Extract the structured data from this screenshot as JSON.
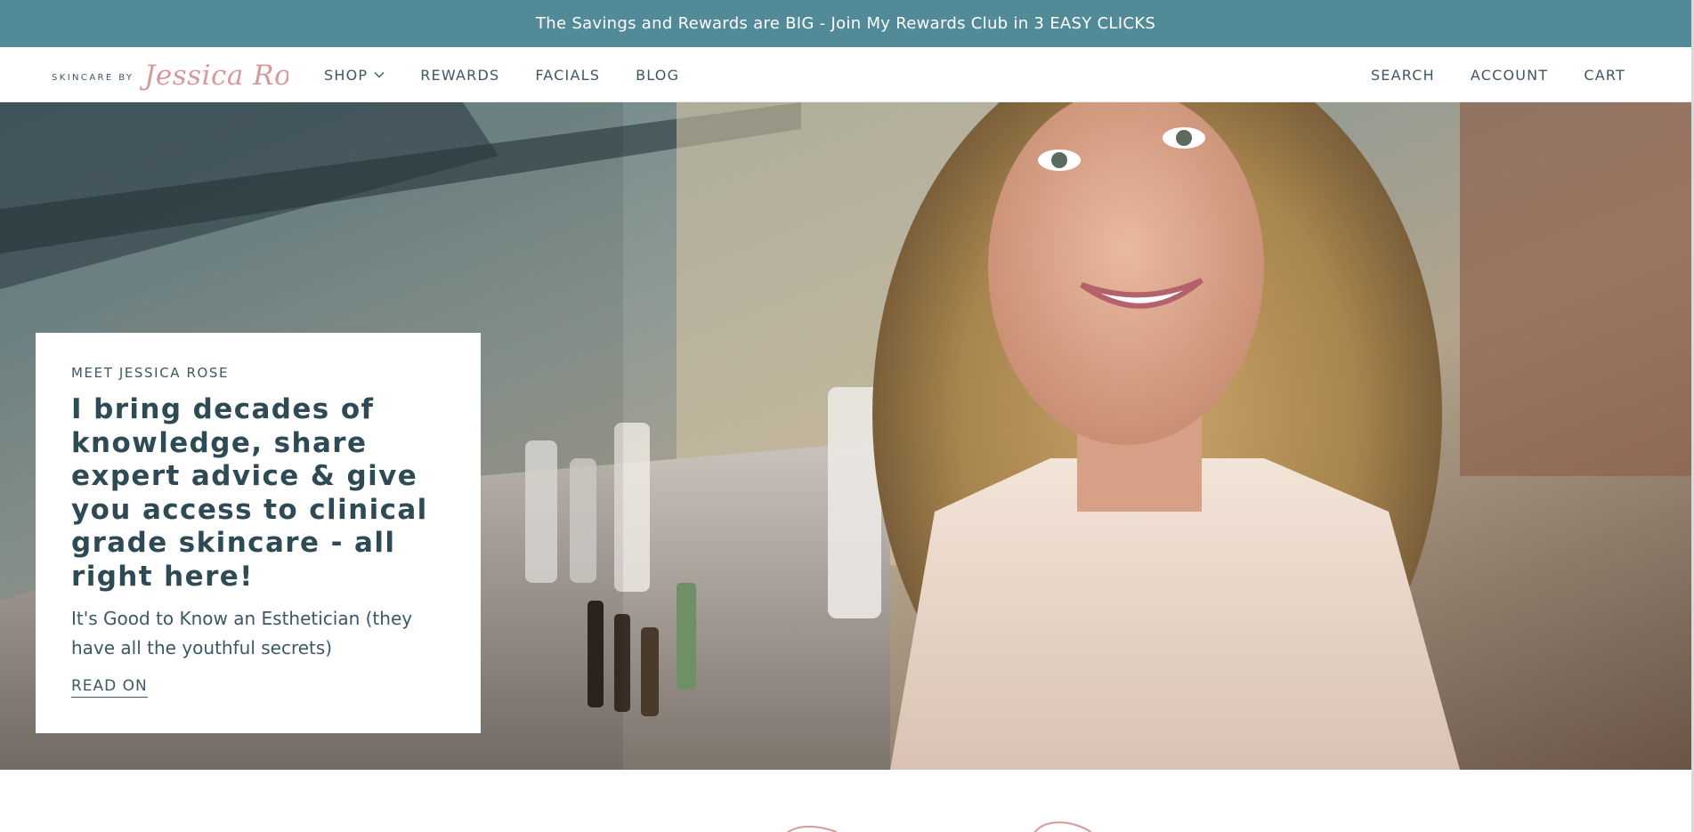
{
  "announcement": {
    "text": "The Savings and Rewards are BIG - Join My Rewards Club in 3 EASY CLICKS"
  },
  "header": {
    "logo": {
      "prefix": "SKINCARE BY",
      "script": "Jessica Rose"
    },
    "nav_left": [
      {
        "label": "SHOP",
        "icon": "chevron-down-icon"
      },
      {
        "label": "REWARDS"
      },
      {
        "label": "FACIALS"
      },
      {
        "label": "BLOG"
      }
    ],
    "nav_right": [
      {
        "label": "SEARCH"
      },
      {
        "label": "ACCOUNT"
      },
      {
        "label": "CART"
      }
    ]
  },
  "hero": {
    "eyebrow": "MEET JESSICA ROSE",
    "headline": "I bring decades of knowledge, share expert advice & give you access to clinical grade skincare - all right here!",
    "subtext": "It's Good to Know an Esthetician (they have all the youthful secrets)",
    "cta": "READ ON"
  },
  "colors": {
    "announcement_bg": "#538a98",
    "text_primary": "#2d4a55",
    "logo_script": "#d59a9c"
  }
}
